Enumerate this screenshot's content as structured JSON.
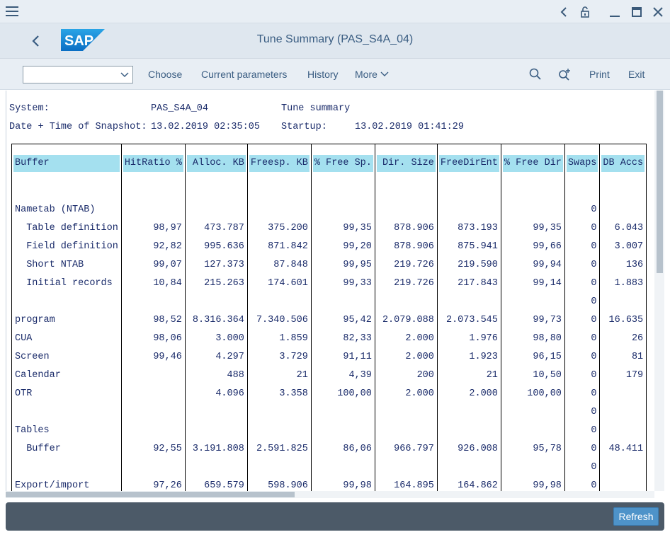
{
  "window": {
    "title": "Tune Summary (PAS_S4A_04)"
  },
  "toolbar": {
    "dropdown_value": "",
    "choose": "Choose",
    "current_parameters": "Current parameters",
    "history": "History",
    "more": "More",
    "print": "Print",
    "exit": "Exit"
  },
  "header": {
    "system_label": "System:",
    "system_value": "PAS_S4A_04",
    "report_name": "Tune summary",
    "snapshot_label": "Date + Time of Snapshot:",
    "snapshot_value": "13.02.2019 02:35:05",
    "startup_label": "Startup:",
    "startup_value": "13.02.2019 01:41:29"
  },
  "table": {
    "columns": [
      "Buffer",
      "HitRatio %",
      "Alloc. KB",
      "Freesp. KB",
      "% Free Sp.",
      "Dir. Size",
      "FreeDirEnt",
      "% Free Dir",
      "Swaps",
      "DB Accs"
    ],
    "rows": [
      [
        "",
        "",
        "",
        "",
        "",
        "",
        "",
        "",
        "",
        ""
      ],
      [
        "Nametab (NTAB)",
        "",
        "",
        "",
        "",
        "",
        "",
        "",
        "0",
        ""
      ],
      [
        "  Table definition",
        "98,97",
        "473.787",
        "375.200",
        "99,35",
        "878.906",
        "873.193",
        "99,35",
        "0",
        "6.043"
      ],
      [
        "  Field definition",
        "92,82",
        "995.636",
        "871.842",
        "99,20",
        "878.906",
        "875.941",
        "99,66",
        "0",
        "3.007"
      ],
      [
        "  Short NTAB",
        "99,07",
        "127.373",
        "87.848",
        "99,95",
        "219.726",
        "219.590",
        "99,94",
        "0",
        "136"
      ],
      [
        "  Initial records",
        "10,84",
        "215.263",
        "174.601",
        "99,33",
        "219.726",
        "217.843",
        "99,14",
        "0",
        "1.883"
      ],
      [
        "",
        "",
        "",
        "",
        "",
        "",
        "",
        "",
        "0",
        ""
      ],
      [
        "program",
        "98,52",
        "8.316.364",
        "7.340.506",
        "95,42",
        "2.079.088",
        "2.073.545",
        "99,73",
        "0",
        "16.635"
      ],
      [
        "CUA",
        "98,06",
        "3.000",
        "1.859",
        "82,33",
        "2.000",
        "1.976",
        "98,80",
        "0",
        "26"
      ],
      [
        "Screen",
        "99,46",
        "4.297",
        "3.729",
        "91,11",
        "2.000",
        "1.923",
        "96,15",
        "0",
        "81"
      ],
      [
        "Calendar",
        "",
        "488",
        "21",
        "4,39",
        "200",
        "21",
        "10,50",
        "0",
        "179"
      ],
      [
        "OTR",
        "",
        "4.096",
        "3.358",
        "100,00",
        "2.000",
        "2.000",
        "100,00",
        "0",
        ""
      ],
      [
        "",
        "",
        "",
        "",
        "",
        "",
        "",
        "",
        "0",
        ""
      ],
      [
        "Tables",
        "",
        "",
        "",
        "",
        "",
        "",
        "",
        "0",
        ""
      ],
      [
        "  Buffer",
        "92,55",
        "3.191.808",
        "2.591.825",
        "86,06",
        "966.797",
        "926.008",
        "95,78",
        "0",
        "48.411"
      ],
      [
        "",
        "",
        "",
        "",
        "",
        "",
        "",
        "",
        "0",
        ""
      ],
      [
        "Export/import",
        "97,26",
        "659.579",
        "598.906",
        "99,98",
        "164.895",
        "164.862",
        "99,98",
        "0",
        ""
      ]
    ]
  },
  "footer": {
    "refresh": "Refresh"
  },
  "colors": {
    "header_cell": "#a4e0ef",
    "accent": "#4e93c9",
    "footer_bg": "#4c5a68"
  }
}
